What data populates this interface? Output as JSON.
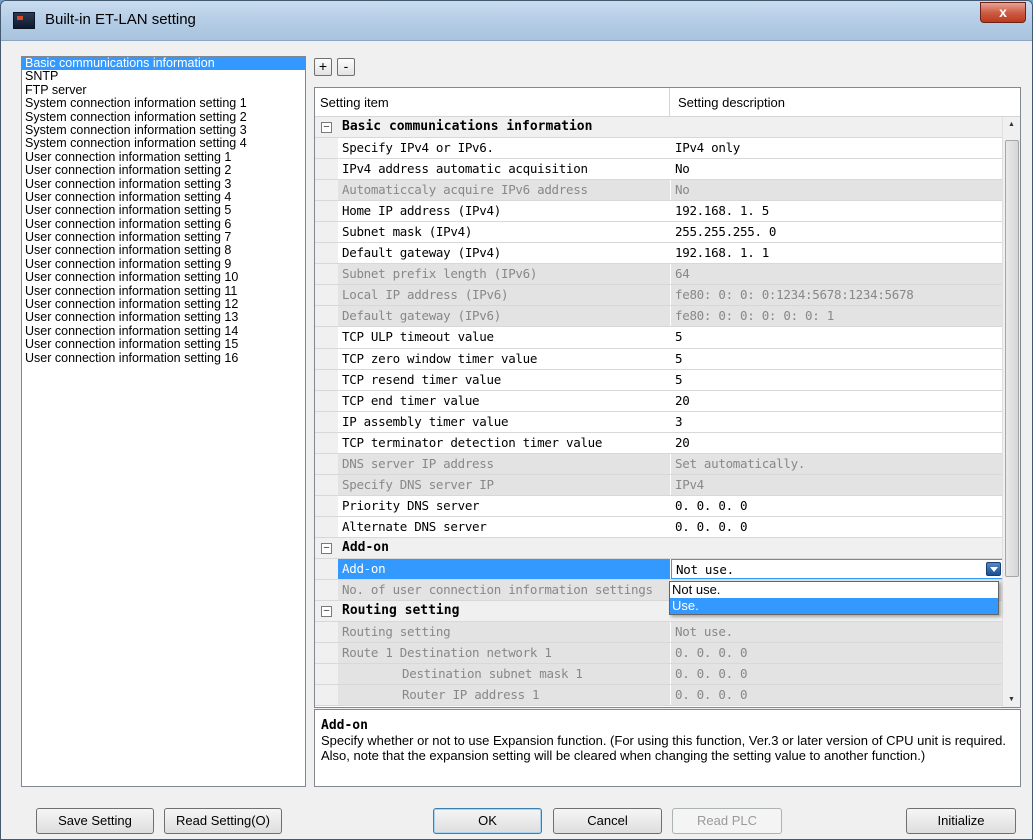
{
  "window": {
    "title": "Built-in ET-LAN setting",
    "close_label": "x"
  },
  "tree": {
    "items": [
      "Basic communications information",
      "SNTP",
      "FTP server",
      "System connection information setting 1",
      "System connection information setting 2",
      "System connection information setting 3",
      "System connection information setting 4",
      "User connection information setting 1",
      "User connection information setting 2",
      "User connection information setting 3",
      "User connection information setting 4",
      "User connection information setting 5",
      "User connection information setting 6",
      "User connection information setting 7",
      "User connection information setting 8",
      "User connection information setting 9",
      "User connection information setting 10",
      "User connection information setting 11",
      "User connection information setting 12",
      "User connection information setting 13",
      "User connection information setting 14",
      "User connection information setting 15",
      "User connection information setting 16"
    ],
    "selected_index": 0
  },
  "toolbar": {
    "expand_label": "+",
    "collapse_label": "-"
  },
  "grid": {
    "header": {
      "item": "Setting item",
      "description": "Setting description"
    },
    "rows": [
      {
        "kind": "category",
        "name": "Basic communications information",
        "expanded_glyph": "−"
      },
      {
        "kind": "item",
        "name": "Specify IPv4 or IPv6.",
        "value": "IPv4 only"
      },
      {
        "kind": "item",
        "name": "IPv4 address automatic acquisition",
        "value": "No"
      },
      {
        "kind": "item",
        "name": "Automaticcaly acquire IPv6 address",
        "value": "No",
        "disabled": true
      },
      {
        "kind": "item",
        "name": "Home IP address (IPv4)",
        "value": "192.168.  1.  5"
      },
      {
        "kind": "item",
        "name": "Subnet mask (IPv4)",
        "value": "255.255.255.  0"
      },
      {
        "kind": "item",
        "name": "Default gateway (IPv4)",
        "value": "192.168.  1.  1"
      },
      {
        "kind": "item",
        "name": "Subnet prefix length (IPv6)",
        "value": "64",
        "disabled": true
      },
      {
        "kind": "item",
        "name": "Local IP address (IPv6)",
        "value": "fe80:   0:   0:   0:1234:5678:1234:5678",
        "disabled": true
      },
      {
        "kind": "item",
        "name": "Default gateway (IPv6)",
        "value": "fe80:   0:   0:   0:   0:   0:   1",
        "disabled": true
      },
      {
        "kind": "item",
        "name": "TCP ULP timeout value",
        "value": "5"
      },
      {
        "kind": "item",
        "name": "TCP zero window timer value",
        "value": "5"
      },
      {
        "kind": "item",
        "name": "TCP resend timer value",
        "value": "5"
      },
      {
        "kind": "item",
        "name": "TCP end timer value",
        "value": "20"
      },
      {
        "kind": "item",
        "name": "IP assembly timer value",
        "value": "3"
      },
      {
        "kind": "item",
        "name": "TCP terminator detection timer value",
        "value": "20"
      },
      {
        "kind": "item",
        "name": "DNS server IP address",
        "value": "Set automatically.",
        "disabled": true
      },
      {
        "kind": "item",
        "name": "Specify DNS server IP",
        "value": "IPv4",
        "disabled": true
      },
      {
        "kind": "item",
        "name": "Priority DNS server",
        "value": "  0.  0.  0.  0"
      },
      {
        "kind": "item",
        "name": "Alternate DNS server",
        "value": "  0.  0.  0.  0"
      },
      {
        "kind": "category",
        "name": "Add-on",
        "expanded_glyph": "−"
      },
      {
        "kind": "item",
        "name": "Add-on",
        "value": "Not use.",
        "selected": true,
        "dropdown": true
      },
      {
        "kind": "item",
        "name": "No. of user connection information settings",
        "value": "",
        "disabled": true
      },
      {
        "kind": "category",
        "name": "Routing setting",
        "expanded_glyph": "−"
      },
      {
        "kind": "item",
        "name": "Routing setting",
        "value": "Not use.",
        "disabled": true
      },
      {
        "kind": "item",
        "name": "Route 1 Destination network 1",
        "value": "  0.  0.  0.  0",
        "disabled": true
      },
      {
        "kind": "item",
        "name": "Destination subnet mask 1",
        "value": "  0.  0.  0.  0",
        "disabled": true,
        "indent": true
      },
      {
        "kind": "item",
        "name": "Router IP address 1",
        "value": "  0.  0.  0.  0",
        "disabled": true,
        "indent": true
      }
    ]
  },
  "dropdown": {
    "options": [
      "Not use.",
      "Use."
    ],
    "highlighted_index": 1
  },
  "description": {
    "title": "Add-on",
    "text": "Specify whether or not to use Expansion function. (For using this function, Ver.3 or later version of CPU unit is required. Also, note that the expansion setting will be cleared when changing the setting value to another function.)"
  },
  "buttons": {
    "save_setting": "Save Setting",
    "read_setting": "Read Setting(O)",
    "ok": "OK",
    "cancel": "Cancel",
    "read_plc": "Read PLC",
    "initialize": "Initialize"
  }
}
